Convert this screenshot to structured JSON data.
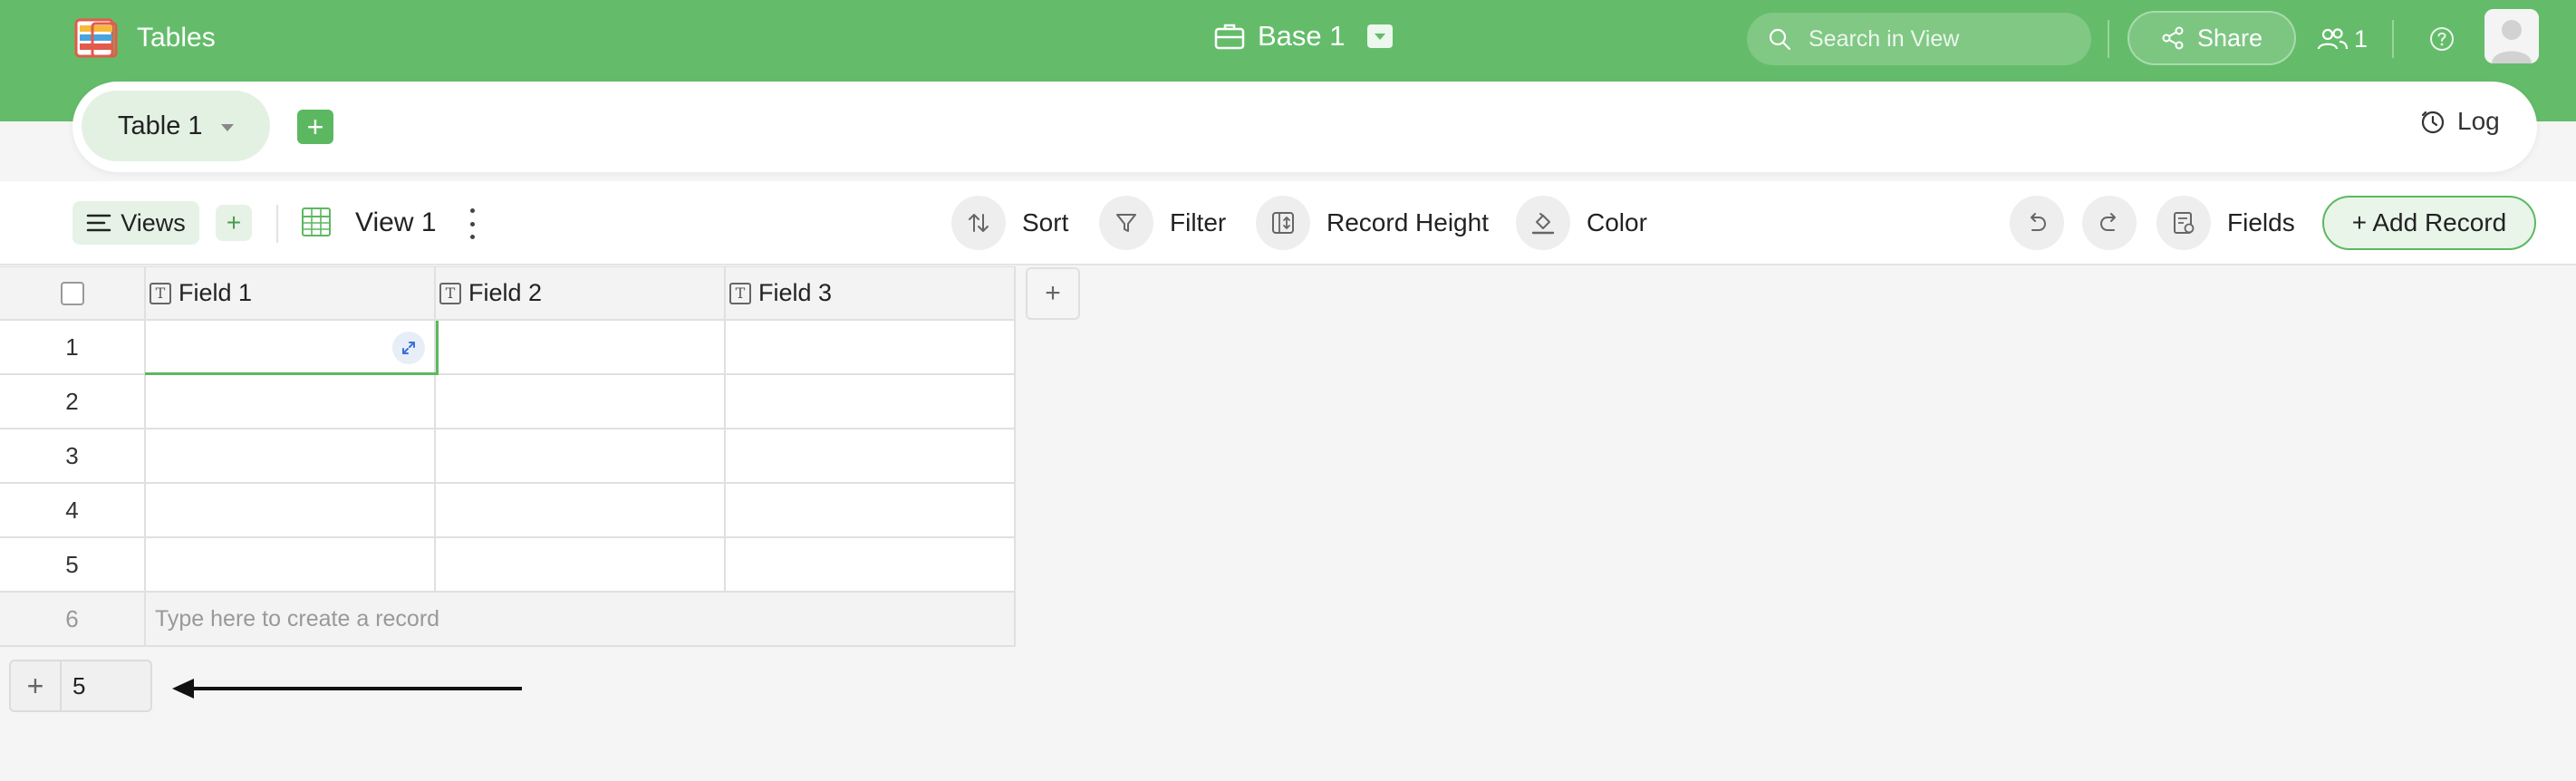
{
  "header": {
    "app_title": "Tables",
    "base_name": "Base 1",
    "search_placeholder": "Search in View",
    "share_label": "Share",
    "collaborator_count": "1",
    "colors": {
      "brand": "#64bc6a",
      "accent": "#5cb860"
    }
  },
  "table_bar": {
    "active_table": "Table 1",
    "log_label": "Log"
  },
  "toolbar": {
    "views_label": "Views",
    "view_name": "View 1",
    "sort_label": "Sort",
    "filter_label": "Filter",
    "record_height_label": "Record Height",
    "color_label": "Color",
    "fields_label": "Fields",
    "add_record_label": "+ Add Record"
  },
  "grid": {
    "columns": [
      "Field 1",
      "Field 2",
      "Field 3"
    ],
    "row_numbers": [
      "1",
      "2",
      "3",
      "4",
      "5"
    ],
    "new_row_number": "6",
    "new_row_hint": "Type here to create a record"
  },
  "footer": {
    "add_rows_count": "5"
  },
  "icons": [
    "logo-icon",
    "briefcase-icon",
    "search-icon",
    "share-icon",
    "users-icon",
    "help-icon",
    "avatar",
    "clock-icon",
    "list-icon",
    "grid-view-icon",
    "sort-icon",
    "filter-icon",
    "record-height-icon",
    "paint-bucket-icon",
    "undo-icon",
    "redo-icon",
    "fields-icon",
    "expand-icon",
    "text-field-icon",
    "arrow-icon"
  ]
}
